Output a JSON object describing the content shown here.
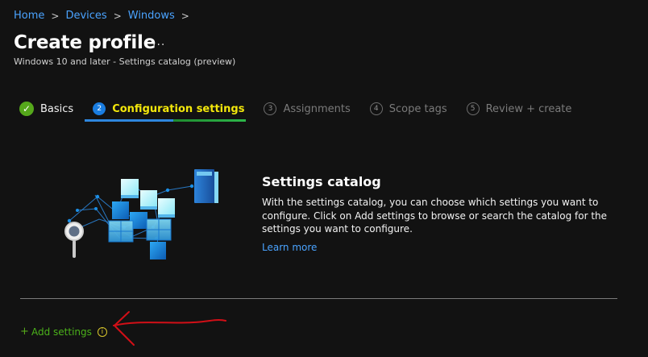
{
  "breadcrumb": {
    "items": [
      "Home",
      "Devices",
      "Windows"
    ]
  },
  "header": {
    "title": "Create profile",
    "more_label": "...",
    "subtitle": "Windows 10 and later - Settings catalog (preview)"
  },
  "tabs": [
    {
      "number": "",
      "label": "Basics",
      "state": "done",
      "icon": "checkmark-icon"
    },
    {
      "number": "2",
      "label": "Configuration settings",
      "state": "current",
      "icon": "step-2-icon"
    },
    {
      "number": "3",
      "label": "Assignments",
      "state": "upcoming",
      "icon": "step-3-icon"
    },
    {
      "number": "4",
      "label": "Scope tags",
      "state": "upcoming",
      "icon": "step-4-icon"
    },
    {
      "number": "5",
      "label": "Review + create",
      "state": "upcoming",
      "icon": "step-5-icon"
    }
  ],
  "catalog": {
    "title": "Settings catalog",
    "description": "With the settings catalog, you can choose which settings you want to configure. Click on Add settings to browse or search the catalog for the settings you want to configure.",
    "learn_more": "Learn more"
  },
  "footer": {
    "add_settings_label": "Add settings",
    "plus_symbol": "+",
    "info_symbol": "i"
  },
  "colors": {
    "background": "#121212",
    "link": "#4aa3ff",
    "accent_yellow": "#f3e70b",
    "success_green": "#55a81b",
    "divider": "#7b7b7b",
    "arrow_red": "#d20f17"
  },
  "icons": {
    "more": "more-horizontal-icon",
    "breadcrumb_separator": "chevron-right-icon",
    "illustration": "settings-catalog-illustration",
    "info": "info-icon",
    "annotation": "red-arrow-annotation"
  }
}
